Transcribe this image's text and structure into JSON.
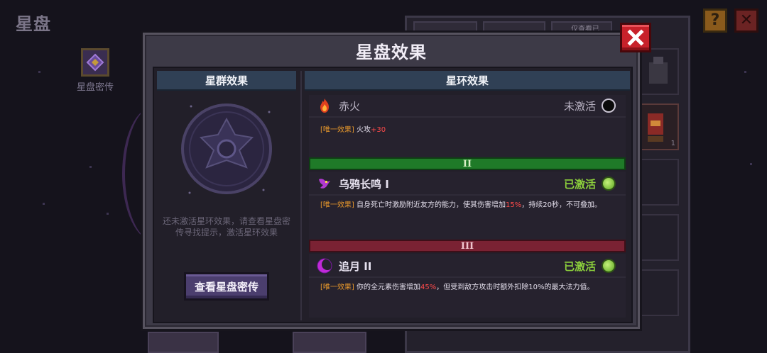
{
  "background": {
    "title": "星盘",
    "legend_label": "星盘密传",
    "help_label": "?",
    "close_label": "✕",
    "side_slot_count": "1",
    "tab_label": "仅查看已"
  },
  "modal": {
    "title": "星盘效果",
    "close_icon": "close-x-icon",
    "left": {
      "header": "星群效果",
      "hint": "还未激活星环效果，请查看星盘密传寻找提示，激活星环效果",
      "view_button": "查看星盘密传"
    },
    "right": {
      "header": "星环效果",
      "effects": [
        {
          "name": "赤火",
          "icon": "fire-icon",
          "status": "未激活",
          "active": false,
          "tag": "[唯一效果]",
          "desc_pre": "火攻",
          "desc_num": "+30",
          "desc_post": ""
        },
        {
          "tier": "II",
          "tier_color": "#1f7a28",
          "name": "乌鸦长鸣 I",
          "icon": "raven-icon",
          "status": "已激活",
          "active": true,
          "tag": "[唯一效果]",
          "desc_pre": "自身死亡时激励附近友方的能力，使其伤害增加",
          "desc_num": "15%",
          "desc_post": "，持续20秒，不可叠加。"
        },
        {
          "tier": "III",
          "tier_color": "#7a2233",
          "name": "追月 II",
          "icon": "crescent-moon-icon",
          "status": "已激活",
          "active": true,
          "tag": "[唯一效果]",
          "desc_pre": "你的全元素伤害增加",
          "desc_num": "45%",
          "desc_post": "，但受到敌方攻击时额外扣除10%的最大法力值。"
        }
      ]
    }
  },
  "colors": {
    "active_green": "#8ccf3c",
    "unique_tag": "#e6972c",
    "number_red": "#ff4a4a",
    "header_blue": "#304055",
    "close_red": "#c8212a"
  }
}
